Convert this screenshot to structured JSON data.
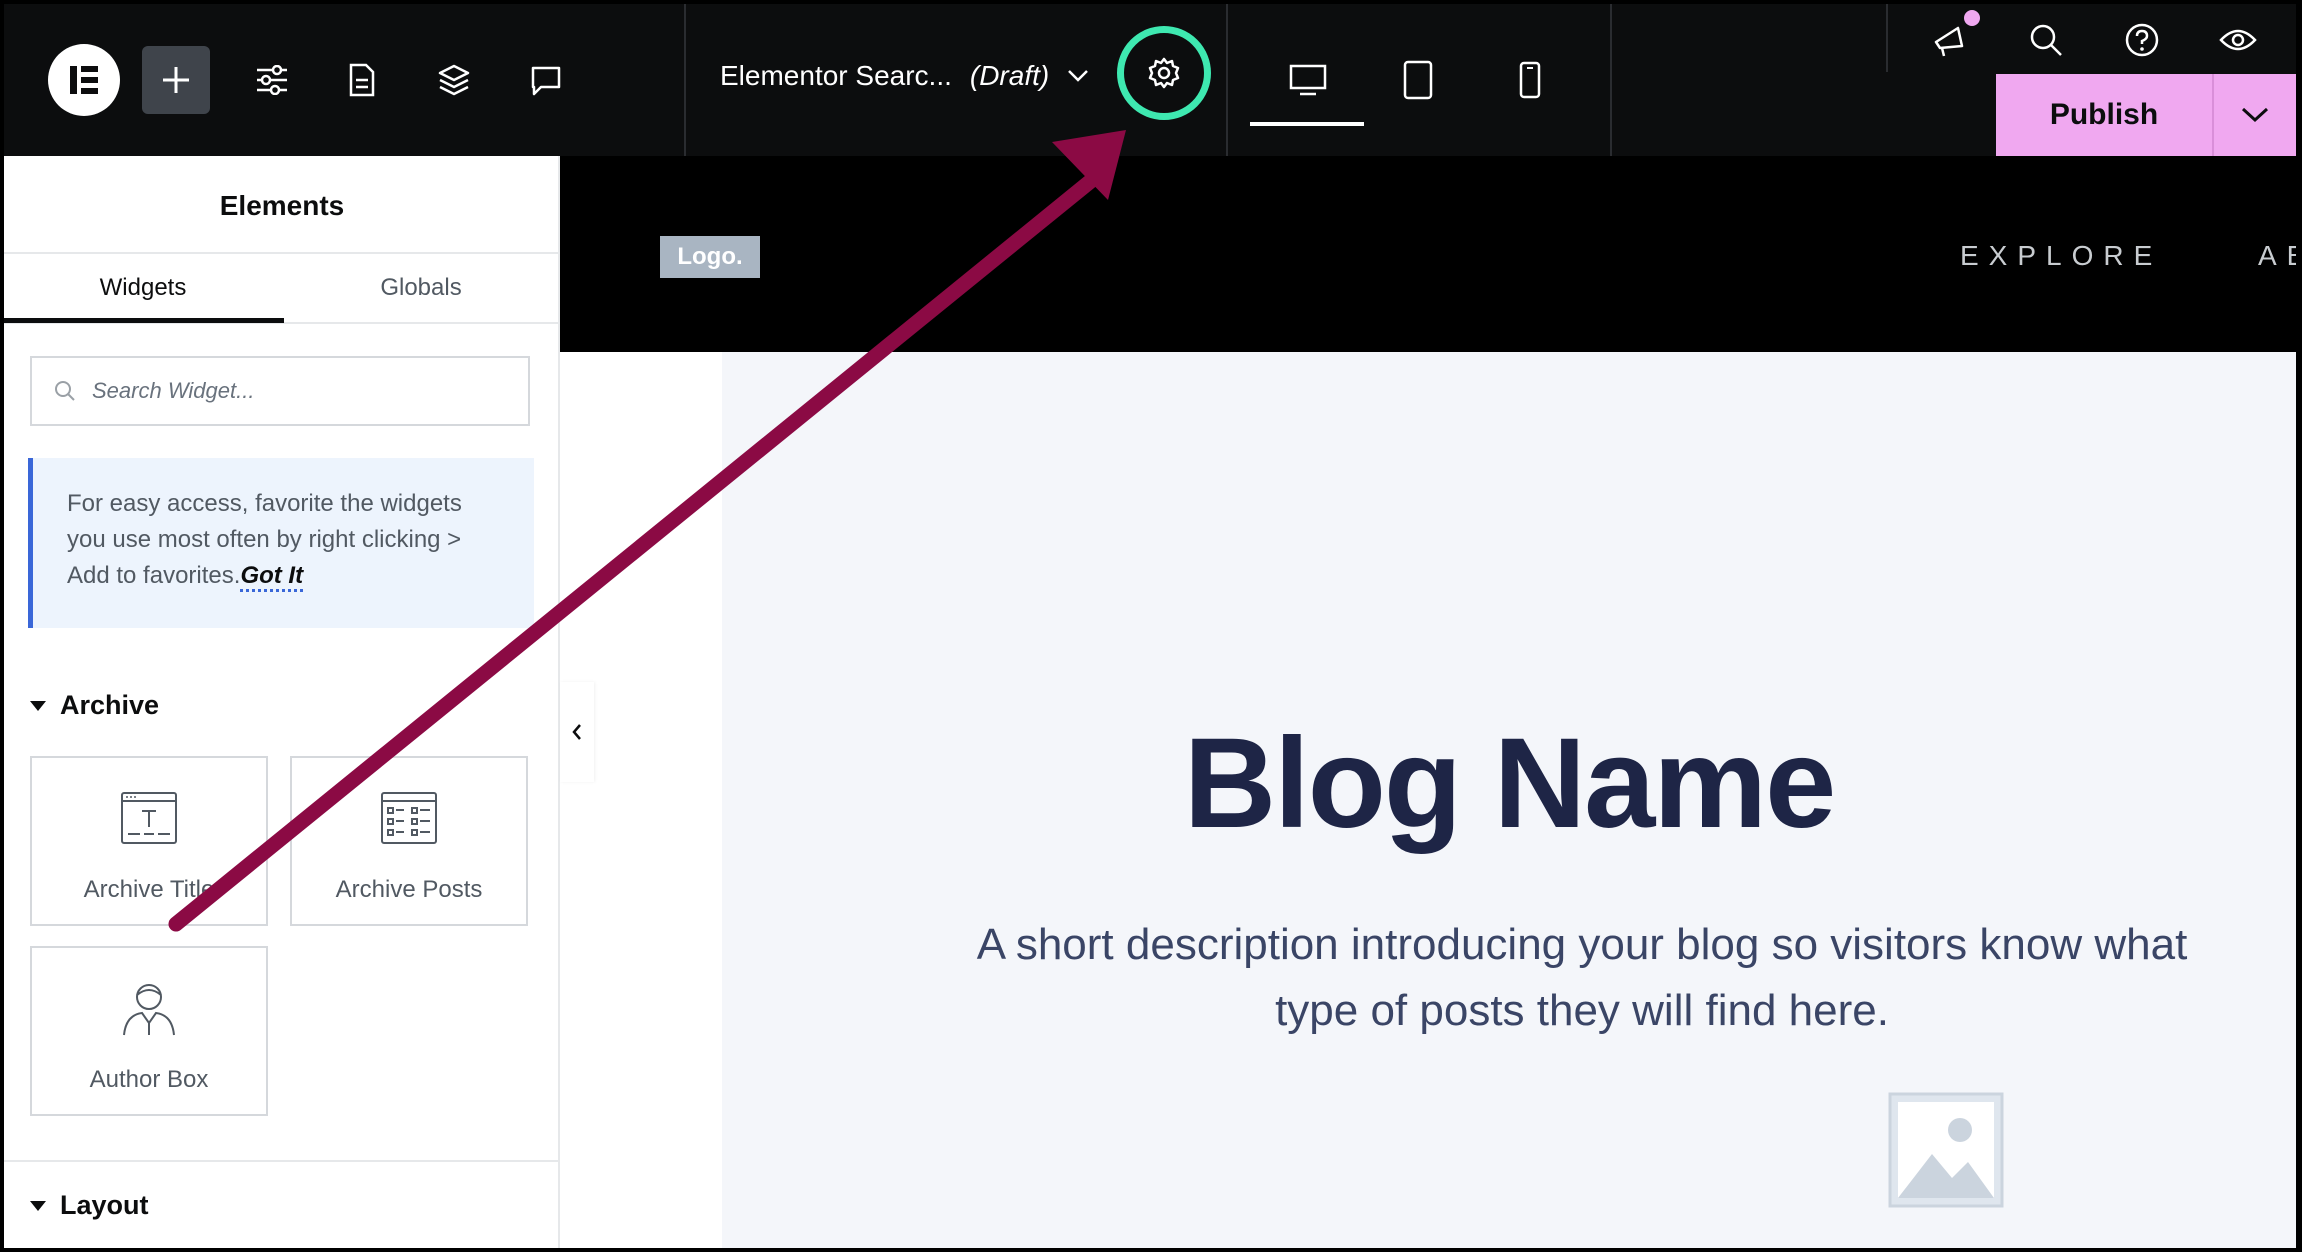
{
  "topbar": {
    "doc_title": "Elementor Searc...",
    "doc_status": "(Draft)",
    "publish_label": "Publish"
  },
  "panel": {
    "title": "Elements",
    "tabs": [
      {
        "label": "Widgets",
        "active": true
      },
      {
        "label": "Globals",
        "active": false
      }
    ],
    "search_placeholder": "Search Widget...",
    "tip_text": "For easy access, favorite the widgets you use most often by right clicking > Add to favorites.",
    "tip_link": "Got It",
    "sections": [
      {
        "title": "Archive",
        "widgets": [
          {
            "label": "Archive Title",
            "icon": "archive-title-icon"
          },
          {
            "label": "Archive Posts",
            "icon": "archive-posts-icon"
          },
          {
            "label": "Author Box",
            "icon": "author-box-icon"
          }
        ]
      },
      {
        "title": "Layout",
        "widgets": []
      }
    ]
  },
  "canvas": {
    "logo": "Logo.",
    "nav": [
      "EXPLORE",
      "AB"
    ],
    "hero_title": "Blog Name",
    "hero_desc": "A short description introducing your blog so visitors know what type of posts they will find here."
  },
  "colors": {
    "accent_publish": "#f0a8f0",
    "highlight_ring": "#3ee8b0",
    "annotation_arrow": "#8b0a44",
    "hero_title": "#1e2546"
  }
}
